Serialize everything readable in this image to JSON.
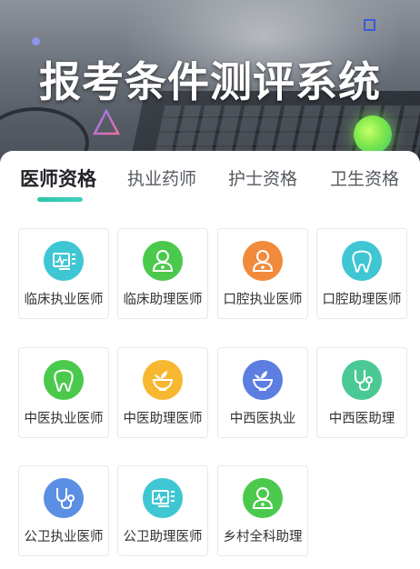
{
  "banner": {
    "title": "报考条件测评系统"
  },
  "tabs": [
    {
      "label": "医师资格",
      "active": true
    },
    {
      "label": "执业药师",
      "active": false
    },
    {
      "label": "护士资格",
      "active": false
    },
    {
      "label": "卫生资格",
      "active": false
    }
  ],
  "accent_color": "#2ec4a6",
  "items": [
    {
      "label": "临床执业医师",
      "icon": "monitor-chart-icon",
      "color": "#3fc6d3"
    },
    {
      "label": "临床助理医师",
      "icon": "doctor-icon",
      "color": "#4bc94c"
    },
    {
      "label": "口腔执业医师",
      "icon": "doctor-icon",
      "color": "#f28a3c"
    },
    {
      "label": "口腔助理医师",
      "icon": "tooth-icon",
      "color": "#3fc6d3"
    },
    {
      "label": "中医执业医师",
      "icon": "tooth-icon",
      "color": "#4bc94c"
    },
    {
      "label": "中医助理医师",
      "icon": "herb-bowl-icon",
      "color": "#f7b731"
    },
    {
      "label": "中西医执业",
      "icon": "herb-bowl-icon",
      "color": "#5b7ee0"
    },
    {
      "label": "中西医助理",
      "icon": "stethoscope-icon",
      "color": "#4bc994"
    },
    {
      "label": "公卫执业医师",
      "icon": "stethoscope-icon",
      "color": "#5b8fe3"
    },
    {
      "label": "公卫助理医师",
      "icon": "monitor-chart-icon",
      "color": "#3fc6d3"
    },
    {
      "label": "乡村全科助理",
      "icon": "doctor-icon",
      "color": "#4bc94c"
    }
  ]
}
